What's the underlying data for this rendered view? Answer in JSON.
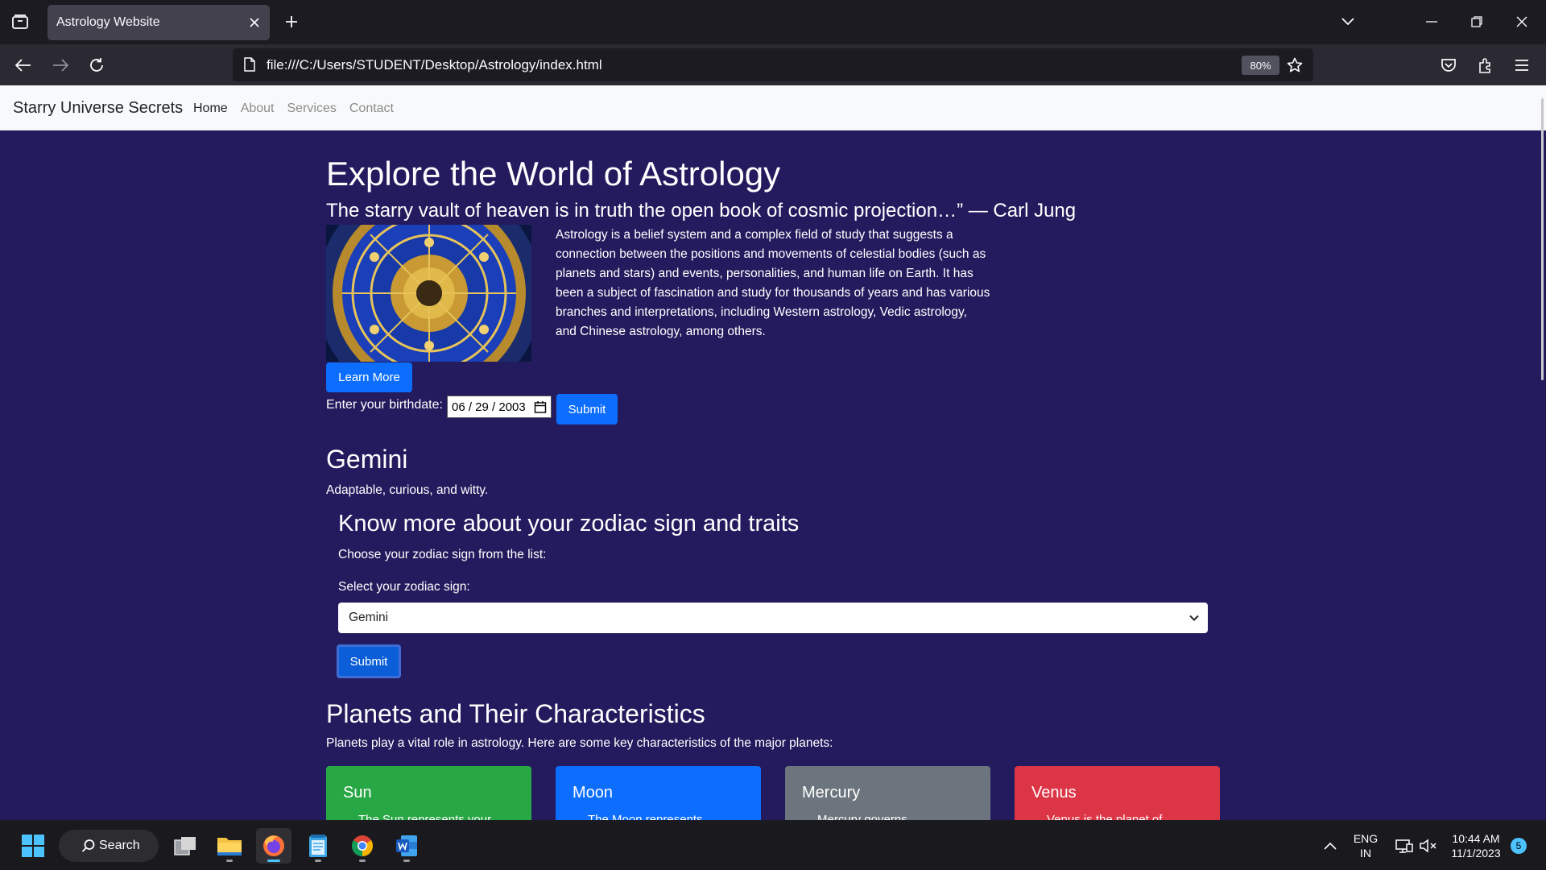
{
  "browser": {
    "tab_title": "Astrology Website",
    "url": "file:///C:/Users/STUDENT/Desktop/Astrology/index.html",
    "zoom": "80%"
  },
  "site": {
    "brand": "Starry Universe Secrets",
    "nav": [
      "Home",
      "About",
      "Services",
      "Contact"
    ],
    "active_nav": "Home"
  },
  "hero": {
    "title": "Explore the World of Astrology",
    "quote": "The starry vault of heaven is in truth the open book of cosmic projection…” — Carl Jung",
    "intro": "Astrology is a belief system and a complex field of study that suggests a connection between the positions and movements of celestial bodies (such as planets and stars) and events, personalities, and human life on Earth. It has been a subject of fascination and study for thousands of years and has various branches and interpretations, including Western astrology, Vedic astrology, and Chinese astrology, among others.",
    "learn_more": "Learn More"
  },
  "birthdate": {
    "label": "Enter your birthdate:",
    "value": "06 / 29 / 2003",
    "submit": "Submit"
  },
  "sign": {
    "name": "Gemini",
    "description": "Adaptable, curious, and witty."
  },
  "zodiac_form": {
    "heading": "Know more about your zodiac sign and traits",
    "choose_text": "Choose your zodiac sign from the list:",
    "select_label": "Select your zodiac sign:",
    "selected": "Gemini",
    "submit": "Submit"
  },
  "planets": {
    "heading": "Planets and Their Characteristics",
    "description": "Planets play a vital role in astrology. Here are some key characteristics of the major planets:",
    "cards": [
      {
        "name": "Sun",
        "line": "The Sun represents your",
        "color": "#28a745"
      },
      {
        "name": "Moon",
        "line": "The Moon represents",
        "color": "#0d6efd"
      },
      {
        "name": "Mercury",
        "line": "Mercury governs",
        "color": "#6c757d"
      },
      {
        "name": "Venus",
        "line": "Venus is the planet of",
        "color": "#dc3545"
      }
    ]
  },
  "taskbar": {
    "search_label": "Search",
    "lang_top": "ENG",
    "lang_bottom": "IN",
    "time": "10:44 AM",
    "date": "11/1/2023",
    "notifications": "5"
  },
  "colors": {
    "page_bg": "#241b5e",
    "primary": "#0d6efd"
  }
}
